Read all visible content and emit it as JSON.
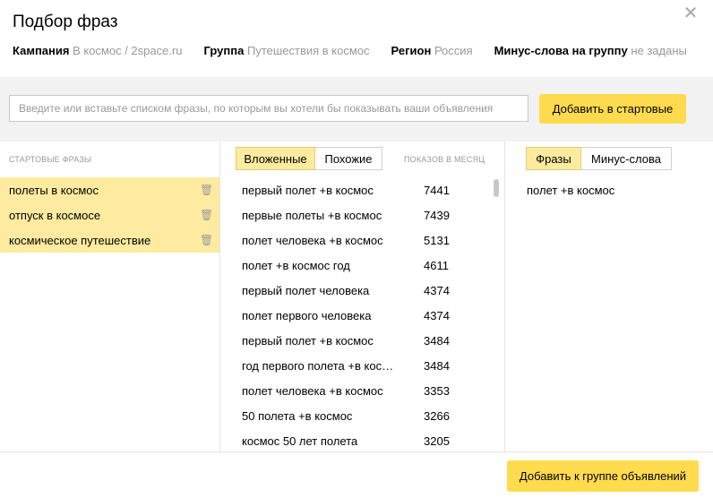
{
  "dialog": {
    "title": "Подбор фраз",
    "close_glyph": "✕"
  },
  "meta": {
    "campaign_label": "Кампания",
    "campaign_value": "В космос / 2space.ru",
    "group_label": "Группа",
    "group_value": "Путешествия в космос",
    "region_label": "Регион",
    "region_value": "Россия",
    "minus_label": "Минус-слова на группу",
    "minus_value": "не заданы"
  },
  "input": {
    "placeholder": "Введите или вставьте списком фразы, по которым вы хотели бы показывать ваши объявления",
    "value": "",
    "add_button": "Добавить в стартовые"
  },
  "start": {
    "header": "Стартовые фразы",
    "items": [
      {
        "label": "полеты в космос"
      },
      {
        "label": "отпуск в космосе"
      },
      {
        "label": "космическое путешествие"
      }
    ]
  },
  "middle": {
    "tabs": [
      {
        "label": "Вложенные",
        "active": true
      },
      {
        "label": "Похожие",
        "active": false
      }
    ],
    "shows_header": "Показов в месяц",
    "rows": [
      {
        "phrase": "первый полет +в космос",
        "shows": "7441"
      },
      {
        "phrase": "первые полеты +в космос",
        "shows": "7439"
      },
      {
        "phrase": "полет человека +в космос",
        "shows": "5131"
      },
      {
        "phrase": "полет +в космос год",
        "shows": "4611"
      },
      {
        "phrase": "первый полет человека",
        "shows": "4374"
      },
      {
        "phrase": "полет первого человека",
        "shows": "4374"
      },
      {
        "phrase": "первый полет +в космос",
        "shows": "3484"
      },
      {
        "phrase": "год первого полета +в космос",
        "shows": "3484"
      },
      {
        "phrase": "полет человека +в космос",
        "shows": "3353"
      },
      {
        "phrase": "50 полета +в космос",
        "shows": "3266"
      },
      {
        "phrase": "космос 50 лет полета",
        "shows": "3205"
      }
    ]
  },
  "right": {
    "tabs": [
      {
        "label": "Фразы",
        "active": true
      },
      {
        "label": "Минус-слова",
        "active": false
      }
    ],
    "items": [
      {
        "label": "полет +в космос"
      }
    ]
  },
  "footer": {
    "add_button": "Добавить к группе объявлений"
  },
  "colors": {
    "accent_yellow": "#ffdb4d",
    "selected_yellow": "#ffeba0"
  },
  "icons": {
    "close": "close-icon",
    "trash": "trash-icon"
  }
}
